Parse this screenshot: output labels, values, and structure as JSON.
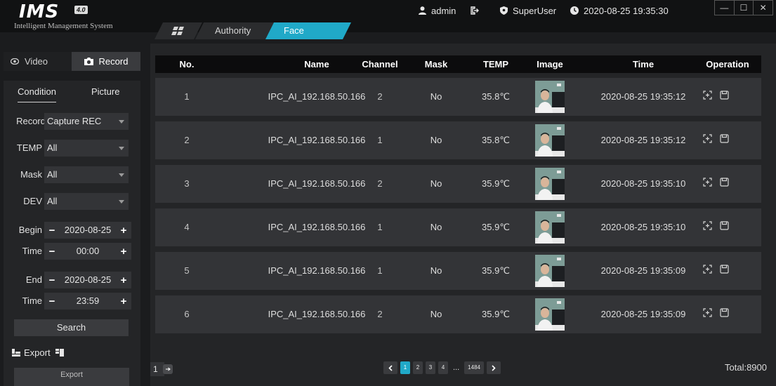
{
  "header": {
    "logo_text": "IMS",
    "logo_version": "4.0",
    "logo_subtitle": "Intelligent Management System",
    "user": "admin",
    "role": "SuperUser",
    "datetime": "2020-08-25 19:35:30",
    "tabs": [
      {
        "label": "Authority"
      },
      {
        "label": "Face"
      }
    ],
    "window_buttons": [
      "—",
      "☐",
      "✕"
    ]
  },
  "sidebar": {
    "mode_video": "Video",
    "mode_record": "Record",
    "sub_tab_condition": "Condition",
    "sub_tab_picture": "Picture",
    "filters": {
      "record_label": "Record",
      "record_value": "Capture REC",
      "temp_label": "TEMP",
      "temp_value": "All",
      "mask_label": "Mask",
      "mask_value": "All",
      "dev_label": "DEV",
      "dev_value": "All",
      "begin_label": "Begin",
      "begin_date": "2020-08-25",
      "begin_time_label": "Time",
      "begin_time": "00:00",
      "end_label": "End",
      "end_date": "2020-08-25",
      "end_time_label": "Time",
      "end_time": "23:59",
      "minus": "−",
      "plus": "+"
    },
    "search_label": "Search",
    "export_label": "Export",
    "export_button_label": "Export"
  },
  "table": {
    "columns": [
      "No.",
      "Name",
      "Channel",
      "Mask",
      "TEMP",
      "Image",
      "Time",
      "Operation"
    ],
    "rows": [
      {
        "no": "1",
        "name": "IPC_AI_192.168.50.166",
        "channel": "2",
        "mask": "No",
        "temp": "35.8℃",
        "time": "2020-08-25 19:35:12"
      },
      {
        "no": "2",
        "name": "IPC_AI_192.168.50.166",
        "channel": "1",
        "mask": "No",
        "temp": "35.8℃",
        "time": "2020-08-25 19:35:12"
      },
      {
        "no": "3",
        "name": "IPC_AI_192.168.50.166",
        "channel": "2",
        "mask": "No",
        "temp": "35.9℃",
        "time": "2020-08-25 19:35:10"
      },
      {
        "no": "4",
        "name": "IPC_AI_192.168.50.166",
        "channel": "1",
        "mask": "No",
        "temp": "35.9℃",
        "time": "2020-08-25 19:35:10"
      },
      {
        "no": "5",
        "name": "IPC_AI_192.168.50.166",
        "channel": "1",
        "mask": "No",
        "temp": "35.9℃",
        "time": "2020-08-25 19:35:09"
      },
      {
        "no": "6",
        "name": "IPC_AI_192.168.50.166",
        "channel": "2",
        "mask": "No",
        "temp": "35.9℃",
        "time": "2020-08-25 19:35:09"
      }
    ]
  },
  "footer": {
    "page_input": "1",
    "pages": [
      "1",
      "2",
      "3",
      "4",
      "...",
      "1484"
    ],
    "current_page": "1",
    "total": "Total:8900"
  },
  "colors": {
    "accent": "#20a9c8",
    "background": "#1b1c1e",
    "panel": "#242527",
    "row": "#333437"
  }
}
